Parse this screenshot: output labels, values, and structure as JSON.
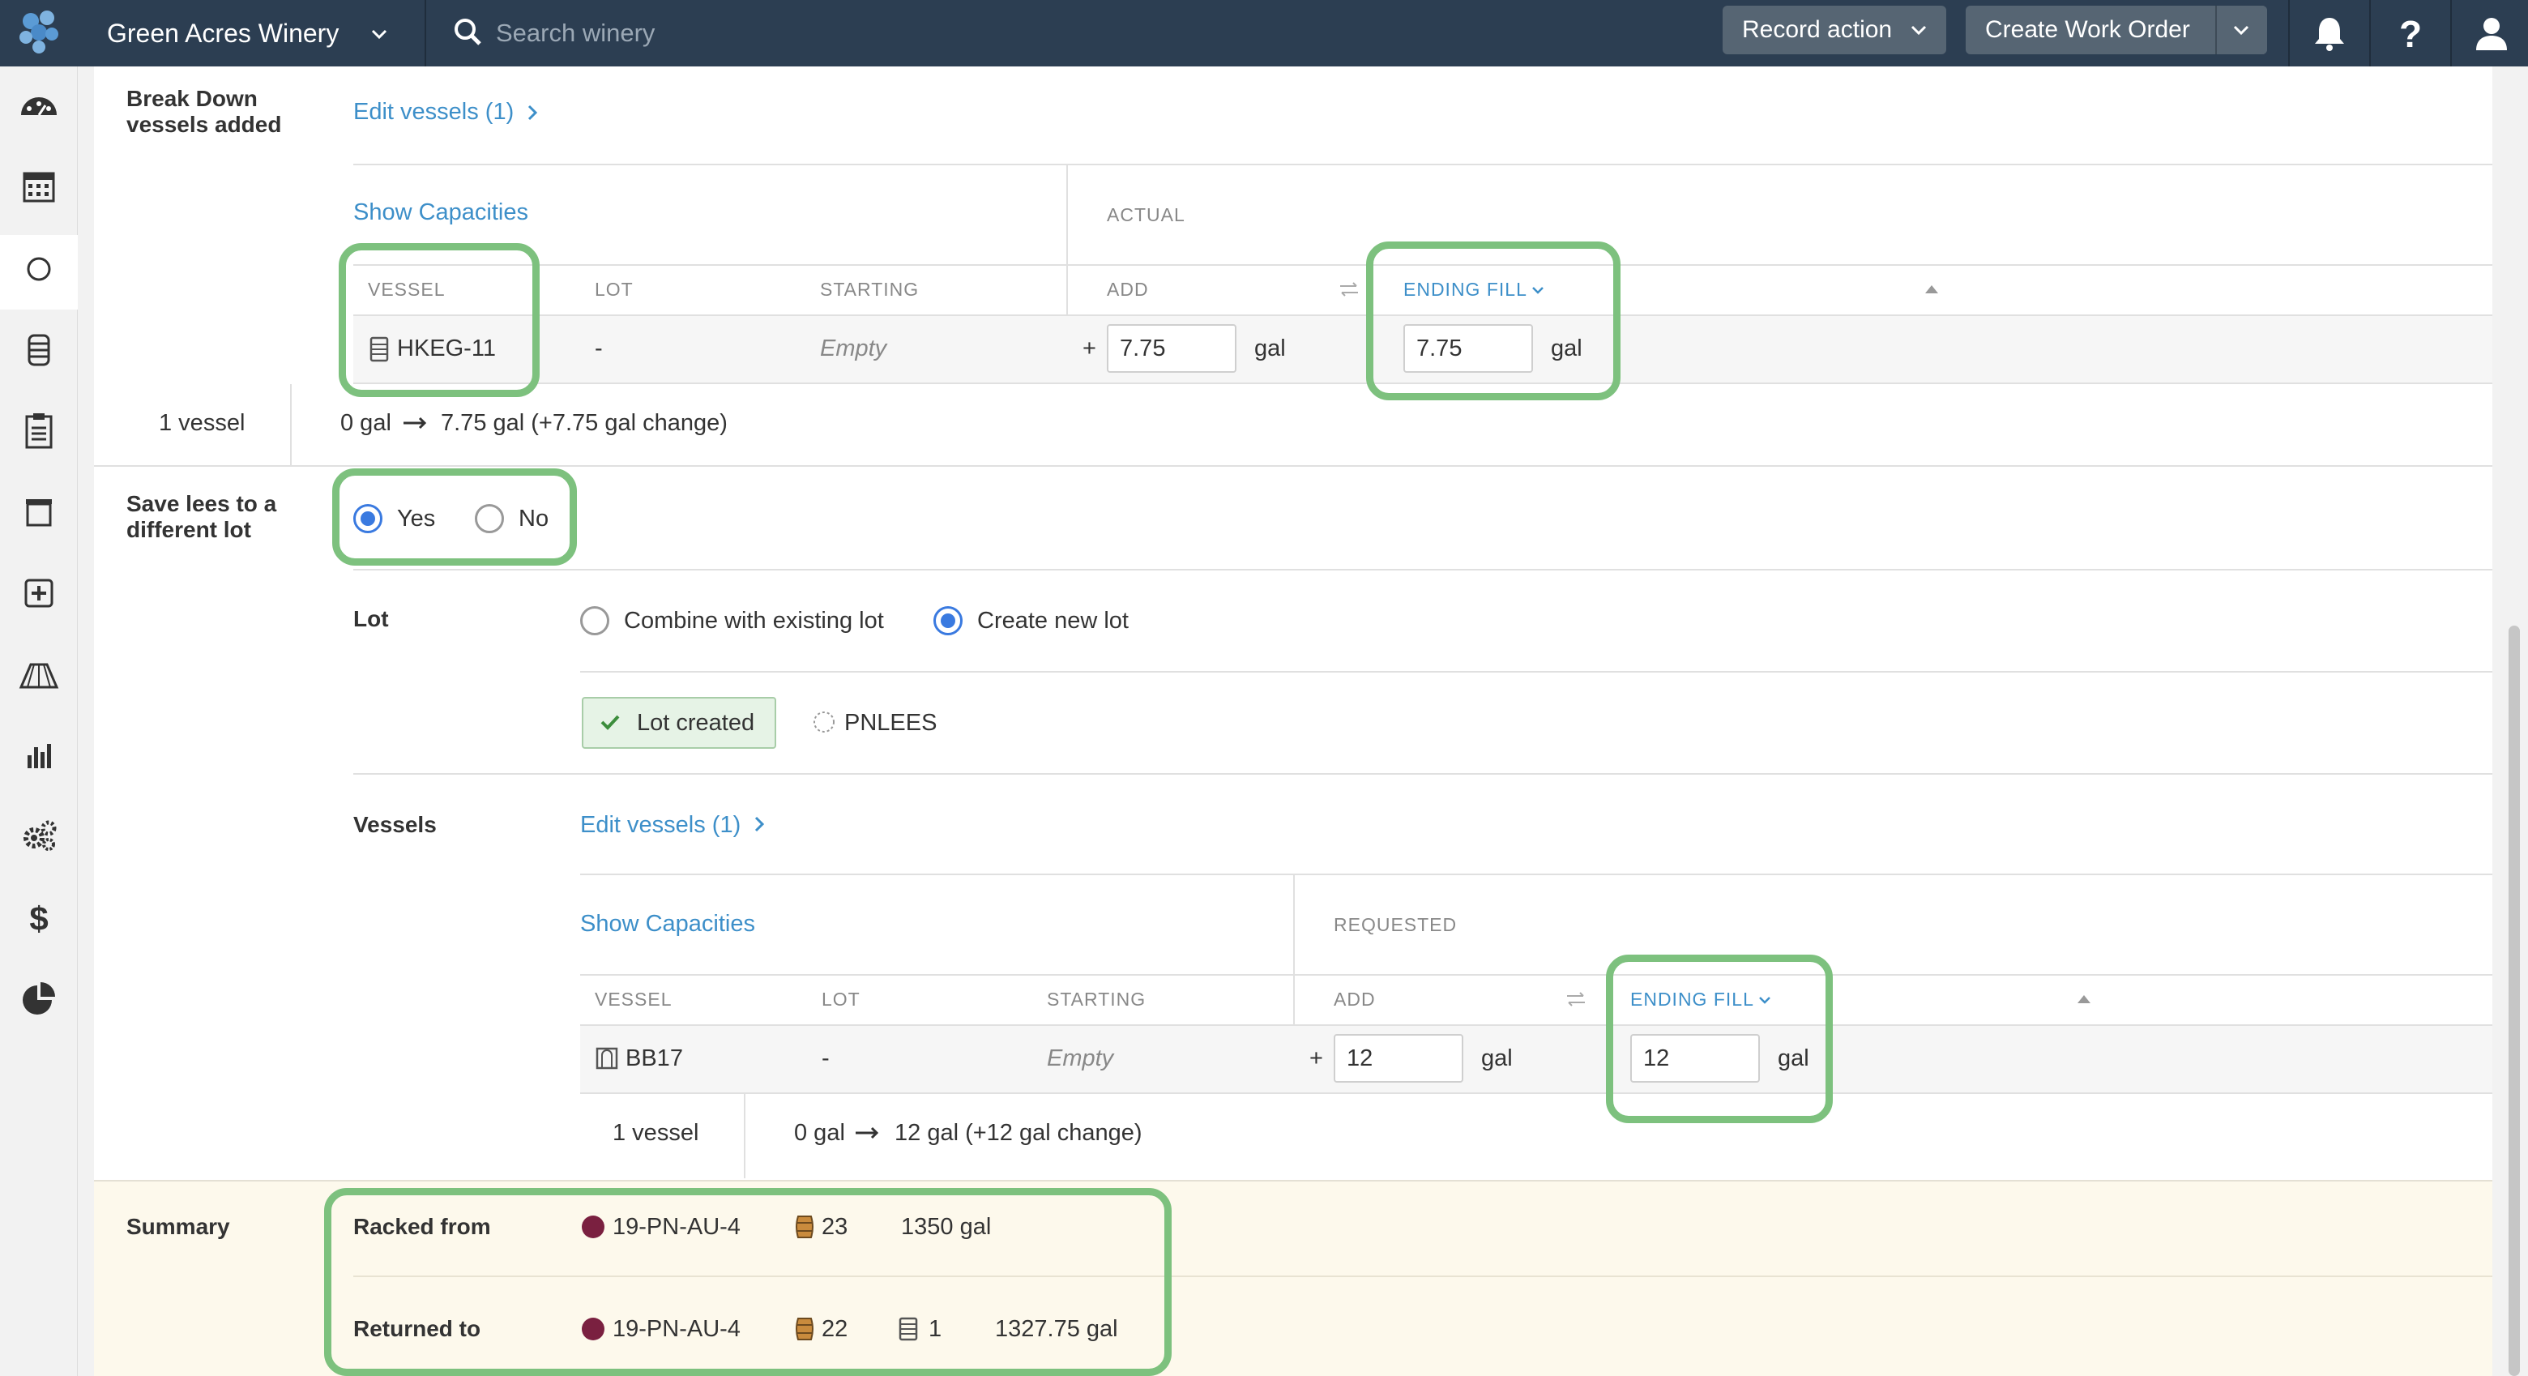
{
  "topbar": {
    "winery_name": "Green Acres Winery",
    "search_placeholder": "Search winery",
    "record_action_label": "Record action",
    "create_work_order_label": "Create Work Order"
  },
  "sidebar": {
    "items": [
      {
        "icon": "dashboard-icon"
      },
      {
        "icon": "calendar-icon"
      },
      {
        "icon": "circle-icon",
        "active": true
      },
      {
        "icon": "barrel-icon"
      },
      {
        "icon": "clipboard-icon"
      },
      {
        "icon": "archive-icon"
      },
      {
        "icon": "plus-square-icon"
      },
      {
        "icon": "vineyard-icon"
      },
      {
        "icon": "bar-chart-icon"
      },
      {
        "icon": "gears-icon"
      },
      {
        "icon": "dollar-icon"
      },
      {
        "icon": "pie-chart-icon"
      }
    ]
  },
  "breakdown": {
    "label": "Break Down vessels added",
    "edit_vessels": "Edit vessels (1)",
    "show_capacities": "Show Capacities",
    "mode_header": "ACTUAL",
    "columns": {
      "vessel": "VESSEL",
      "lot": "LOT",
      "starting": "STARTING",
      "add": "ADD",
      "ending_fill": "ENDING FILL"
    },
    "row": {
      "vessel": "HKEG-11",
      "lot": "-",
      "starting": "Empty",
      "add_sign": "+",
      "add": "7.75",
      "add_unit": "gal",
      "ending": "7.75",
      "ending_unit": "gal"
    },
    "footer_count": "1 vessel",
    "footer_from": "0 gal",
    "footer_to": "7.75 gal (+7.75 gal change)"
  },
  "save_lees": {
    "label": "Save lees to a different lot",
    "yes": "Yes",
    "no": "No",
    "selected": "yes"
  },
  "lot": {
    "label": "Lot",
    "combine": "Combine with existing lot",
    "create_new": "Create new lot",
    "selected": "create_new",
    "created_badge": "Lot created",
    "lot_code": "PNLEES"
  },
  "vessels": {
    "label": "Vessels",
    "edit_vessels": "Edit vessels (1)",
    "show_capacities": "Show Capacities",
    "mode_header": "REQUESTED",
    "columns": {
      "vessel": "VESSEL",
      "lot": "LOT",
      "starting": "STARTING",
      "add": "ADD",
      "ending_fill": "ENDING FILL"
    },
    "row": {
      "vessel": "BB17",
      "lot": "-",
      "starting": "Empty",
      "add_sign": "+",
      "add": "12",
      "add_unit": "gal",
      "ending": "12",
      "ending_unit": "gal"
    },
    "footer_count": "1 vessel",
    "footer_from": "0 gal",
    "footer_to": "12 gal (+12 gal change)"
  },
  "summary": {
    "label": "Summary",
    "racked_from": {
      "label": "Racked from",
      "lot": "19-PN-AU-4",
      "barrels": "23",
      "volume": "1350 gal"
    },
    "returned_to": {
      "label": "Returned to",
      "lot": "19-PN-AU-4",
      "barrels": "22",
      "kegs": "1",
      "volume": "1327.75 gal"
    }
  },
  "colors": {
    "accent_blue": "#3d8fc9",
    "highlight_green": "#7dc17e",
    "topbar": "#2c3e52",
    "wine": "#7a2040"
  }
}
